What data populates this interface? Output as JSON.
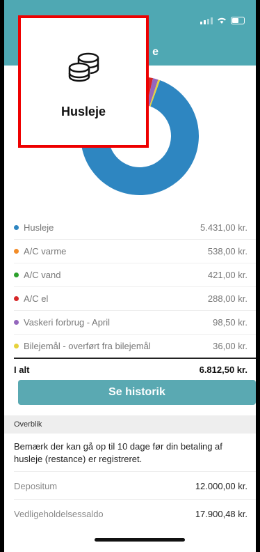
{
  "header": {
    "title_fragment": "e"
  },
  "popup": {
    "icon": "coins-icon",
    "label": "Husleje"
  },
  "chart_data": {
    "type": "pie",
    "categories": [
      "Husleje",
      "A/C varme",
      "A/C vand",
      "A/C el",
      "Vaskeri forbrug - April",
      "Bilejemål - overført fra bilejemål"
    ],
    "values": [
      5431.0,
      538.0,
      421.0,
      288.0,
      98.5,
      36.0
    ],
    "colors": [
      "#2e86c1",
      "#f28c28",
      "#2ca02c",
      "#d62728",
      "#9467bd",
      "#e6d23c"
    ]
  },
  "items": [
    {
      "label": "Husleje",
      "amount": "5.431,00 kr.",
      "color": "#2e86c1"
    },
    {
      "label": "A/C varme",
      "amount": "538,00 kr.",
      "color": "#f28c28"
    },
    {
      "label": "A/C vand",
      "amount": "421,00 kr.",
      "color": "#2ca02c"
    },
    {
      "label": "A/C el",
      "amount": "288,00 kr.",
      "color": "#d62728"
    },
    {
      "label": "Vaskeri forbrug - April",
      "amount": "98,50 kr.",
      "color": "#9467bd"
    },
    {
      "label": "Bilejemål - overført fra bilejemål",
      "amount": "36,00 kr.",
      "color": "#e6d23c"
    }
  ],
  "total": {
    "label": "I alt",
    "amount": "6.812,50 kr."
  },
  "history_button": "Se historik",
  "overview": {
    "heading": "Overblik",
    "note": "Bemærk der kan gå op til 10 dage før din betaling af husleje (restance) er registreret.",
    "deposit_label": "Depositum",
    "deposit_amount": "12.000,00 kr.",
    "maintenance_label": "Vedligeholdelsessaldo",
    "maintenance_amount": "17.900,48 kr."
  }
}
